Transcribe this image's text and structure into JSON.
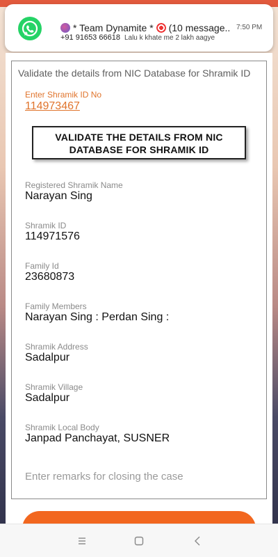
{
  "notification": {
    "app_icon": "whatsapp-icon",
    "title": "* Team Dynamite *",
    "title_suffix": "(10 message..",
    "time": "7:50 PM",
    "sender": "+91 91653 66618",
    "message": "Lalu k khate me 2 lakh aagye"
  },
  "form": {
    "title": "Validate the details from NIC Database for Shramik ID",
    "shramik_id_label": "Enter Shramik ID No",
    "shramik_id_value": "114973467",
    "validate_button_label": "VALIDATE THE DETAILS FROM NIC DATABASE FOR SHRAMIK ID",
    "fields": [
      {
        "label": "Registered Shramik Name",
        "value": "Narayan Sing"
      },
      {
        "label": "Shramik ID",
        "value": "114971576"
      },
      {
        "label": "Family Id",
        "value": "23680873"
      },
      {
        "label": "Family Members",
        "value": "Narayan Sing : Perdan Sing :"
      },
      {
        "label": "Shramik Address",
        "value": "Sadalpur"
      },
      {
        "label": "Shramik Village",
        "value": "Sadalpur"
      },
      {
        "label": "Shramik Local Body",
        "value": "Janpad Panchayat, SUSNER"
      }
    ],
    "remarks_placeholder": "Enter remarks for closing the case"
  },
  "navbar": {
    "icons": [
      "menu-icon",
      "home-icon",
      "back-icon"
    ]
  },
  "colors": {
    "accent": "#e0742c",
    "button_orange": "#f2671f",
    "whatsapp": "#25d366"
  }
}
